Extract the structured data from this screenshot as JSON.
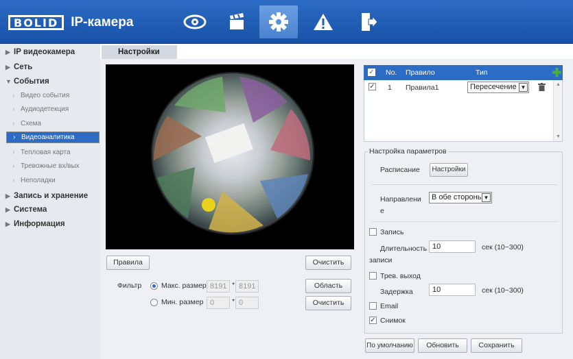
{
  "header": {
    "brand": "BOLID",
    "app_title": "IP-камера",
    "nav_icons": [
      "eye-icon",
      "clapperboard-icon",
      "gear-icon",
      "warning-icon",
      "logout-icon"
    ]
  },
  "sidebar": {
    "items": [
      {
        "label": "IP видеокамера",
        "level": "top",
        "arrow": "▶"
      },
      {
        "label": "Сеть",
        "level": "top",
        "arrow": "▶"
      },
      {
        "label": "События",
        "level": "top",
        "arrow": "▼"
      },
      {
        "label": "Видео события",
        "level": "sub",
        "arrow": "›"
      },
      {
        "label": "Аудиодетекция",
        "level": "sub",
        "arrow": "›"
      },
      {
        "label": "Схема",
        "level": "sub",
        "arrow": "›"
      },
      {
        "label": "Видеоаналитика",
        "level": "sub",
        "arrow": "›",
        "selected": true
      },
      {
        "label": "Тепловая карта",
        "level": "sub",
        "arrow": "›"
      },
      {
        "label": "Тревожные вх/вых",
        "level": "sub",
        "arrow": "›"
      },
      {
        "label": "Неполадки",
        "level": "sub",
        "arrow": "›"
      },
      {
        "label": "Запись и хранение",
        "level": "top",
        "arrow": "▶"
      },
      {
        "label": "Система",
        "level": "top",
        "arrow": "▶"
      },
      {
        "label": "Информация",
        "level": "top",
        "arrow": "▶"
      }
    ]
  },
  "tab": {
    "label": "Настройки"
  },
  "left": {
    "rules_button": "Правила",
    "clear_button": "Очистить",
    "filter_label": "Фильтр",
    "max_size_label": "Макс. размер",
    "max_w": "8191",
    "max_h": "8191",
    "min_size_label": "Мин. размер",
    "min_w": "0",
    "min_h": "0",
    "times": "*",
    "area_button": "Область",
    "clear_button2": "Очистить"
  },
  "rules_table": {
    "headers": {
      "no": "No.",
      "rule": "Правило",
      "type": "Тип"
    },
    "rows": [
      {
        "no": "1",
        "rule": "Правила1",
        "type": "Пересечение"
      }
    ]
  },
  "params": {
    "legend": "Настройка параметров",
    "schedule_label": "Расписание",
    "schedule_button": "Настройки",
    "direction_label_1": "Направлени",
    "direction_label_2": "е",
    "direction_value": "В обе стороны",
    "record_label": "Запись",
    "duration_label_1": "Длительность",
    "duration_label_2": "записи",
    "duration_value": "10",
    "duration_unit": "сек (10~300)",
    "alarm_out_label": "Трев. выход",
    "delay_label": "Задержка",
    "delay_value": "10",
    "delay_unit": "сек (10~300)",
    "email_label": "Email",
    "snapshot_label": "Снимок"
  },
  "footer": {
    "default_button": "По умолчанию",
    "refresh_button": "Обновить",
    "save_button": "Сохранить"
  },
  "colors": {
    "accent": "#2c6cc4",
    "header": "#1f5bb0",
    "sidebar": "#e6e9ee"
  }
}
